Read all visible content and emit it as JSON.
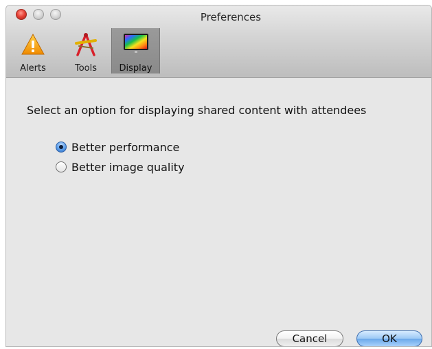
{
  "window": {
    "title": "Preferences"
  },
  "toolbar": {
    "tabs": [
      {
        "label": "Alerts",
        "icon": "warning-icon"
      },
      {
        "label": "Tools",
        "icon": "tools-icon"
      },
      {
        "label": "Display",
        "icon": "display-icon",
        "selected": true
      }
    ]
  },
  "content": {
    "prompt": "Select an option for displaying shared content with attendees",
    "options": [
      {
        "label": "Better performance",
        "selected": true
      },
      {
        "label": "Better image quality",
        "selected": false
      }
    ]
  },
  "buttons": {
    "cancel": "Cancel",
    "ok": "OK"
  },
  "colors": {
    "accent": "#5a9ce8",
    "close": "#e8453a"
  }
}
